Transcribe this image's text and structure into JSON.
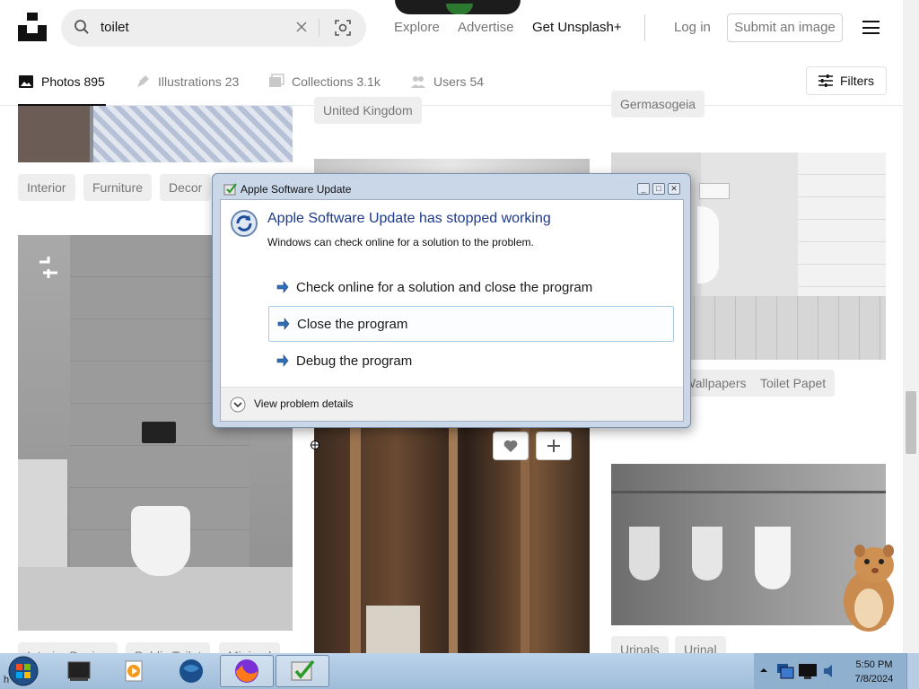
{
  "header": {
    "search_value": "toilet",
    "nav": {
      "explore": "Explore",
      "advertise": "Advertise",
      "unsplash_plus": "Get Unsplash+",
      "login": "Log in",
      "submit": "Submit an image"
    }
  },
  "tabs": [
    {
      "label": "Photos",
      "count": "895"
    },
    {
      "label": "Illustrations",
      "count": "23"
    },
    {
      "label": "Collections",
      "count": "3.1k"
    },
    {
      "label": "Users",
      "count": "54"
    }
  ],
  "filters_label": "Filters",
  "tags": {
    "col1_top": [
      "Interior",
      "Furniture",
      "Decor"
    ],
    "col1_bottom": [
      "Interior Design",
      "Public Toilet",
      "Minimal"
    ],
    "col2_top": "United Kingdom",
    "col3_top": "Germasogeia",
    "col3_mid": [
      "Wallpapers",
      "Toilet Papet"
    ],
    "col3_bottom": [
      "Urinals",
      "Urinal"
    ]
  },
  "dialog": {
    "title": "Apple Software Update",
    "heading": "Apple Software Update has stopped working",
    "subtext": "Windows can check online for a solution to the problem.",
    "options": [
      "Check online for a solution and close the program",
      "Close the program",
      "Debug the program"
    ],
    "details": "View problem details"
  },
  "taskbar": {
    "start_text": "h",
    "time": "5:50 PM",
    "date": "7/8/2024"
  },
  "colors": {
    "accent": "#111111",
    "muted": "#767676",
    "dialog_heading": "#1e3a8a",
    "taskbar": "#a8c4e0"
  }
}
